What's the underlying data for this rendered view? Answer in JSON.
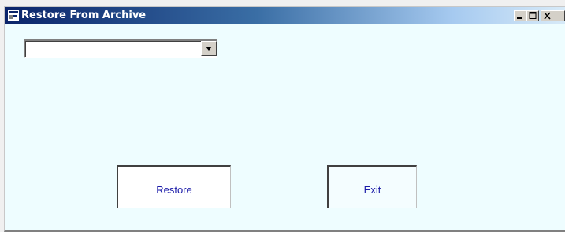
{
  "window": {
    "title": "Restore From Archive",
    "title_icon": "app-window-icon",
    "caption_buttons": [
      "minimize-icon",
      "maximize-icon",
      "close-icon"
    ]
  },
  "form": {
    "archive_select": {
      "value": "",
      "arrow_icon": "chevron-down-icon"
    },
    "restore_label": "Restore",
    "exit_label": "Exit"
  }
}
